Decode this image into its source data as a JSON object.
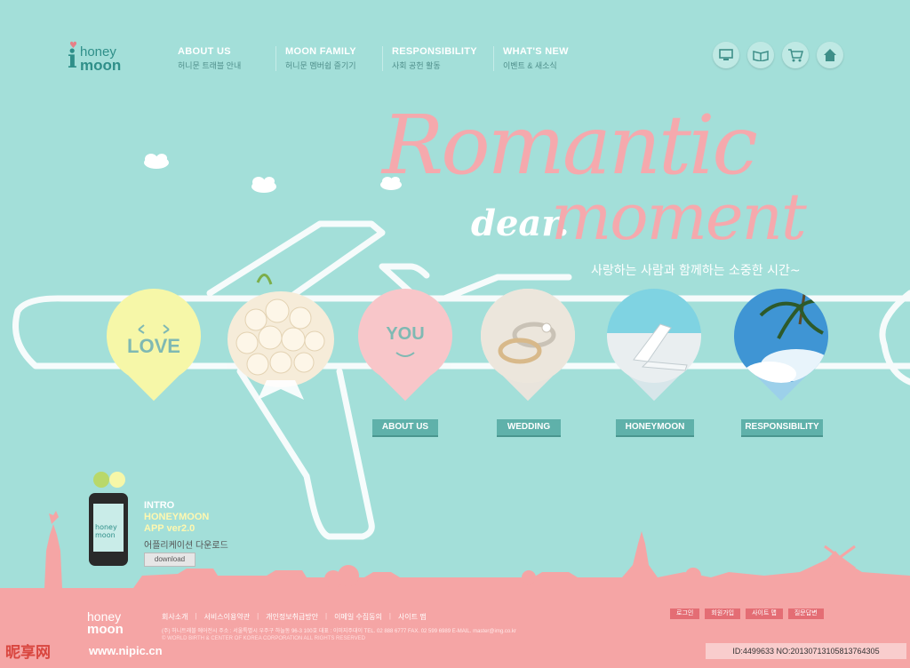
{
  "brand": {
    "logo_line1": "honey",
    "logo_line2": "moon"
  },
  "nav": [
    {
      "title": "ABOUT US",
      "sub": "허니문 트래블 안내"
    },
    {
      "title": "MOON FAMILY",
      "sub": "허니문 멤버쉽 즐기기"
    },
    {
      "title": "RESPONSIBILITY",
      "sub": "사회 공헌 활동"
    },
    {
      "title": "WHAT'S NEW",
      "sub": "이벤트 & 새소식"
    }
  ],
  "top_icons": [
    "computer-icon",
    "book-icon",
    "cart-icon",
    "home-icon"
  ],
  "hero": {
    "romantic": "Romantic",
    "dear": "dear.",
    "moment": "moment",
    "tagline": "사랑하는 사람과 함께하는 소중한 시간~"
  },
  "pins": {
    "love": "LOVE",
    "you": "YOU"
  },
  "buttons": {
    "about": "ABOUT US",
    "wedding": "WEDDING",
    "honeymoon": "HONEYMOON",
    "responsibility": "RESPONSIBILITY"
  },
  "app": {
    "line1": "INTRO",
    "line2": "HONEYMOON",
    "line3": "APP ver2.0",
    "line4": "어플리케이션 다운로드",
    "download": "download",
    "screen_text": "honey moon"
  },
  "footer": {
    "logo_line1": "honey",
    "logo_line2": "moon",
    "links": [
      "회사소개",
      "서비스이용약관",
      "개인정보취급방안",
      "이메일 수집동의",
      "사이트 맵"
    ],
    "info": "(주) 허니트래블 에어전시  주소 : 서울특별시 우주구 하늘동 96-3 100호  대표 : 이미지주대이  TEL. 02 888 6777  FAX. 02 599 6989 E-MAIL. master@img.co.kr",
    "copyright": "© WORLD BIRTH & CENTER OF KOREA CORPORATION ALL RIGHTS RESERVED",
    "buttons": [
      "로그인",
      "회원가입",
      "사이트 맵",
      "질문답변"
    ]
  },
  "watermark": {
    "id_text": "ID:4499633 NO:20130713105813764305",
    "site_name": "昵享网",
    "site_url": "www.nipic.cn"
  },
  "colors": {
    "background": "#a3dfd9",
    "pink": "#f5a9ad",
    "teal": "#5fb1aa",
    "footer": "#f5a5a5"
  }
}
